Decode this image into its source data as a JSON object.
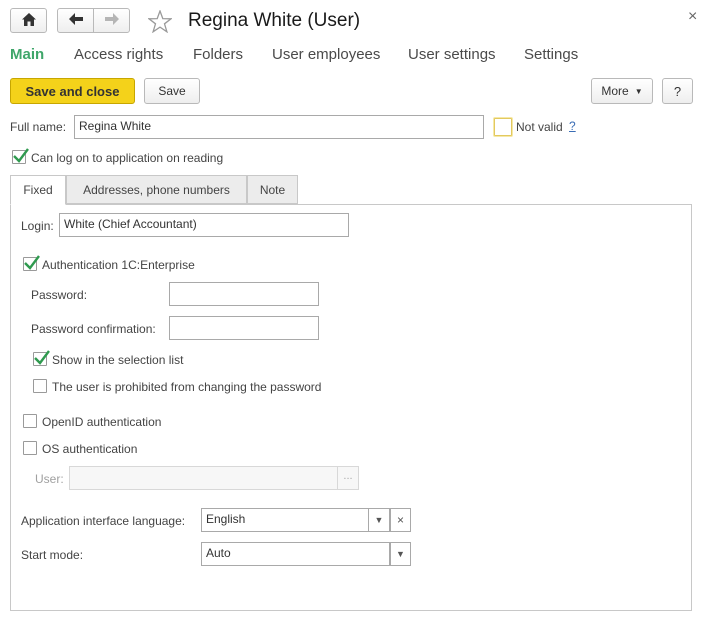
{
  "window": {
    "title": "Regina White (User)",
    "close_glyph": "×"
  },
  "nav_tabs": [
    {
      "label": "Main",
      "active": true
    },
    {
      "label": "Access rights"
    },
    {
      "label": "Folders"
    },
    {
      "label": "User employees"
    },
    {
      "label": "User settings"
    },
    {
      "label": "Settings"
    }
  ],
  "toolbar": {
    "save_and_close": "Save and close",
    "save": "Save",
    "more": "More",
    "help": "?"
  },
  "header_form": {
    "full_name_label": "Full name:",
    "full_name_value": "Regina White",
    "not_valid_label": "Not valid",
    "not_valid_help": "?",
    "not_valid_checked": false,
    "can_log_on_label": "Can log on to application on reading",
    "can_log_on_checked": true
  },
  "inner_tabs": [
    {
      "label": "Fixed",
      "active": true
    },
    {
      "label": "Addresses, phone numbers"
    },
    {
      "label": "Note"
    }
  ],
  "fixed": {
    "login_label": "Login:",
    "login_value": "White (Chief Accountant)",
    "auth_1c_label": "Authentication 1C:Enterprise",
    "auth_1c_checked": true,
    "password_label": "Password:",
    "password_value": "",
    "password_confirm_label": "Password confirmation:",
    "password_confirm_value": "",
    "show_in_list_label": "Show in the selection list",
    "show_in_list_checked": true,
    "prohibited_change_label": "The user is prohibited from changing the password",
    "prohibited_change_checked": false,
    "openid_label": "OpenID authentication",
    "openid_checked": false,
    "os_auth_label": "OS authentication",
    "os_auth_checked": false,
    "os_user_label": "User:",
    "os_user_value": "",
    "os_user_select": "...",
    "lang_label": "Application interface language:",
    "lang_value": "English",
    "lang_clear": "×",
    "start_mode_label": "Start mode:",
    "start_mode_value": "Auto"
  },
  "colors": {
    "accent_green": "#3fa66a",
    "save_close_bg": "#f4d21a",
    "checkbox_check": "#2f9a4f"
  },
  "icons": [
    "home-icon",
    "back-arrow-icon",
    "forward-arrow-icon",
    "star-icon",
    "close-icon",
    "checkmark-icon",
    "dropdown-arrow-icon"
  ]
}
